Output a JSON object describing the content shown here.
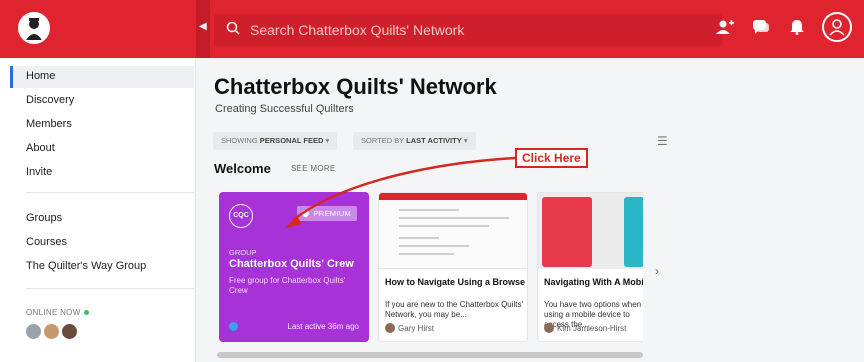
{
  "topbar": {
    "search_placeholder": "Search Chatterbox Quilts' Network",
    "icons": [
      "invite-user-icon",
      "chat-icon",
      "bell-icon",
      "profile-icon"
    ]
  },
  "sidebar": {
    "items": [
      {
        "label": "Home",
        "active": true
      },
      {
        "label": "Discovery"
      },
      {
        "label": "Members"
      },
      {
        "label": "About"
      },
      {
        "label": "Invite"
      }
    ],
    "groups": [
      {
        "label": "Groups"
      },
      {
        "label": "Courses"
      },
      {
        "label": "The Quilter's Way Group"
      }
    ],
    "online_now": "ONLINE NOW"
  },
  "main": {
    "title": "Chatterbox Quilts' Network",
    "subtitle": "Creating Successful Quilters",
    "filter_feed_prefix": "SHOWING",
    "filter_feed_value": "PERSONAL FEED",
    "filter_sort_prefix": "SORTED BY",
    "filter_sort_value": "LAST ACTIVITY",
    "section_title": "Welcome",
    "see_more": "SEE MORE",
    "group_card": {
      "logo": "CQC",
      "badge": "PREMIUM",
      "label": "GROUP",
      "name": "Chatterbox Quilts' Crew",
      "description": "Free group for Chatterbox Quilts' Crew",
      "last_active": "Last active 36m ago"
    },
    "articles": [
      {
        "title": "How to Navigate Using a Browser",
        "excerpt": "If you are new to the Chatterbox Quilts' Network, you may be...",
        "author": "Gary Hirst"
      },
      {
        "title": "Navigating With A Mobile Device",
        "excerpt": "You have two options when using a mobile device to access the...",
        "author": "Kim Jamieson-Hirst"
      }
    ]
  },
  "annotation": {
    "text": "Click Here",
    "color": "#d9271f"
  },
  "colors": {
    "brand_red": "#e0242f",
    "group_purple": "#a632d8",
    "active_blue": "#2a6fd6"
  }
}
